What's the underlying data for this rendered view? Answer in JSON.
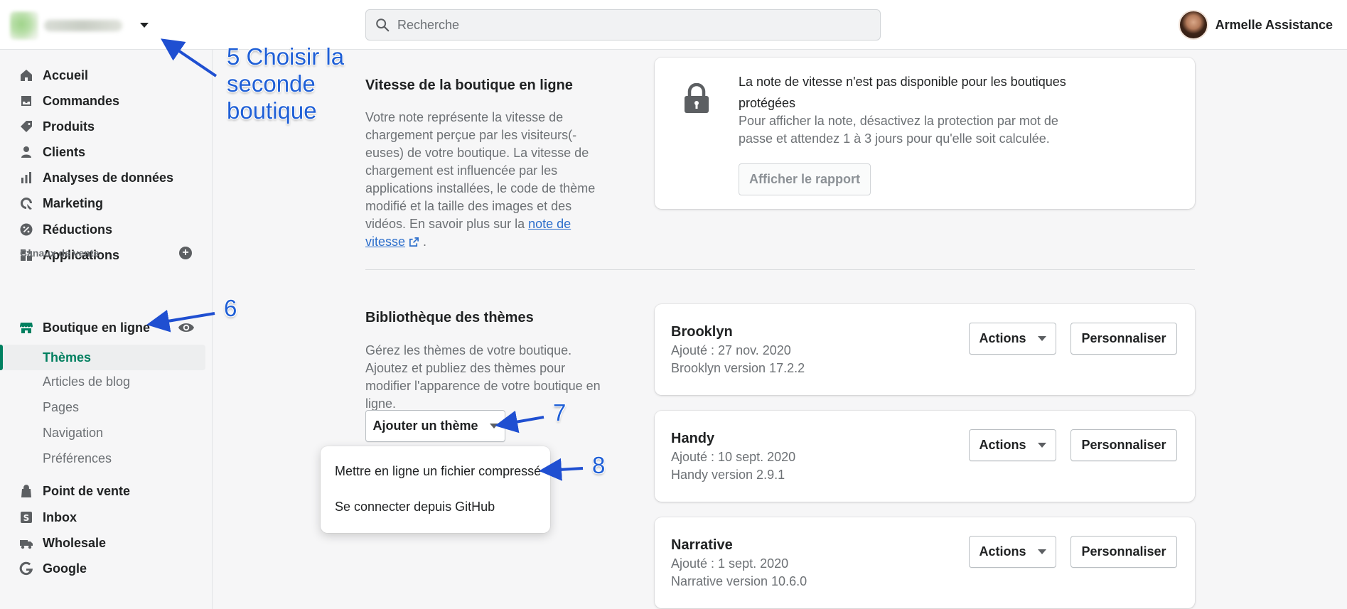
{
  "topbar": {
    "search_placeholder": "Recherche",
    "user_name": "Armelle Assistance"
  },
  "sidebar": {
    "items": [
      {
        "label": "Accueil",
        "icon": "home-icon"
      },
      {
        "label": "Commandes",
        "icon": "orders-icon"
      },
      {
        "label": "Produits",
        "icon": "tag-icon"
      },
      {
        "label": "Clients",
        "icon": "person-icon"
      },
      {
        "label": "Analyses de données",
        "icon": "analytics-icon"
      },
      {
        "label": "Marketing",
        "icon": "marketing-icon"
      },
      {
        "label": "Réductions",
        "icon": "discount-icon"
      },
      {
        "label": "Applications",
        "icon": "apps-icon"
      }
    ],
    "sales_channels_label": "Canaux de vente",
    "online_store": {
      "label": "Boutique en ligne",
      "icon": "store-icon"
    },
    "sub_items": [
      {
        "label": "Thèmes",
        "active": true
      },
      {
        "label": "Articles de blog"
      },
      {
        "label": "Pages"
      },
      {
        "label": "Navigation"
      },
      {
        "label": "Préférences"
      }
    ],
    "channels": [
      {
        "label": "Point de vente",
        "icon": "pos-icon"
      },
      {
        "label": "Inbox",
        "icon": "inbox-icon"
      },
      {
        "label": "Wholesale",
        "icon": "wholesale-icon"
      },
      {
        "label": "Google",
        "icon": "google-icon"
      }
    ]
  },
  "speed": {
    "title": "Vitesse de la boutique en ligne",
    "desc": "Votre note représente la vitesse de chargement perçue par les visiteurs(-euses) de votre boutique. La vitesse de chargement est influencée par les applications installées, le code de thème modifié et la taille des images et des vidéos. En savoir plus sur la",
    "link": "note de vitesse",
    "desc_end": " .",
    "card_title": "La note de vitesse n'est pas disponible pour les boutiques protégées",
    "card_desc": "Pour afficher la note, désactivez la protection par mot de passe et attendez 1 à 3 jours pour qu'elle soit calculée.",
    "report_button": "Afficher le rapport"
  },
  "library": {
    "title": "Bibliothèque des thèmes",
    "desc": "Gérez les thèmes de votre boutique. Ajoutez et publiez des thèmes pour modifier l'apparence de votre boutique en ligne.",
    "add_button": "Ajouter un thème",
    "dropdown": [
      "Mettre en ligne un fichier compressé",
      "Se connecter depuis GitHub"
    ],
    "actions_label": "Actions",
    "customize_label": "Personnaliser",
    "themes": [
      {
        "name": "Brooklyn",
        "added": "Ajouté : 27 nov. 2020",
        "version": "Brooklyn version 17.2.2"
      },
      {
        "name": "Handy",
        "added": "Ajouté : 10 sept. 2020",
        "version": "Handy version 2.9.1"
      },
      {
        "name": "Narrative",
        "added": "Ajouté : 1 sept. 2020",
        "version": "Narrative version 10.6.0"
      }
    ]
  },
  "annotations": {
    "step5": [
      "5 Choisir la",
      "seconde",
      "boutique"
    ],
    "step6": "6",
    "step7": "7",
    "step8": "8"
  },
  "colors": {
    "accent": "#008060",
    "link": "#2c6ecb",
    "annotation": "#1f5fd6"
  }
}
